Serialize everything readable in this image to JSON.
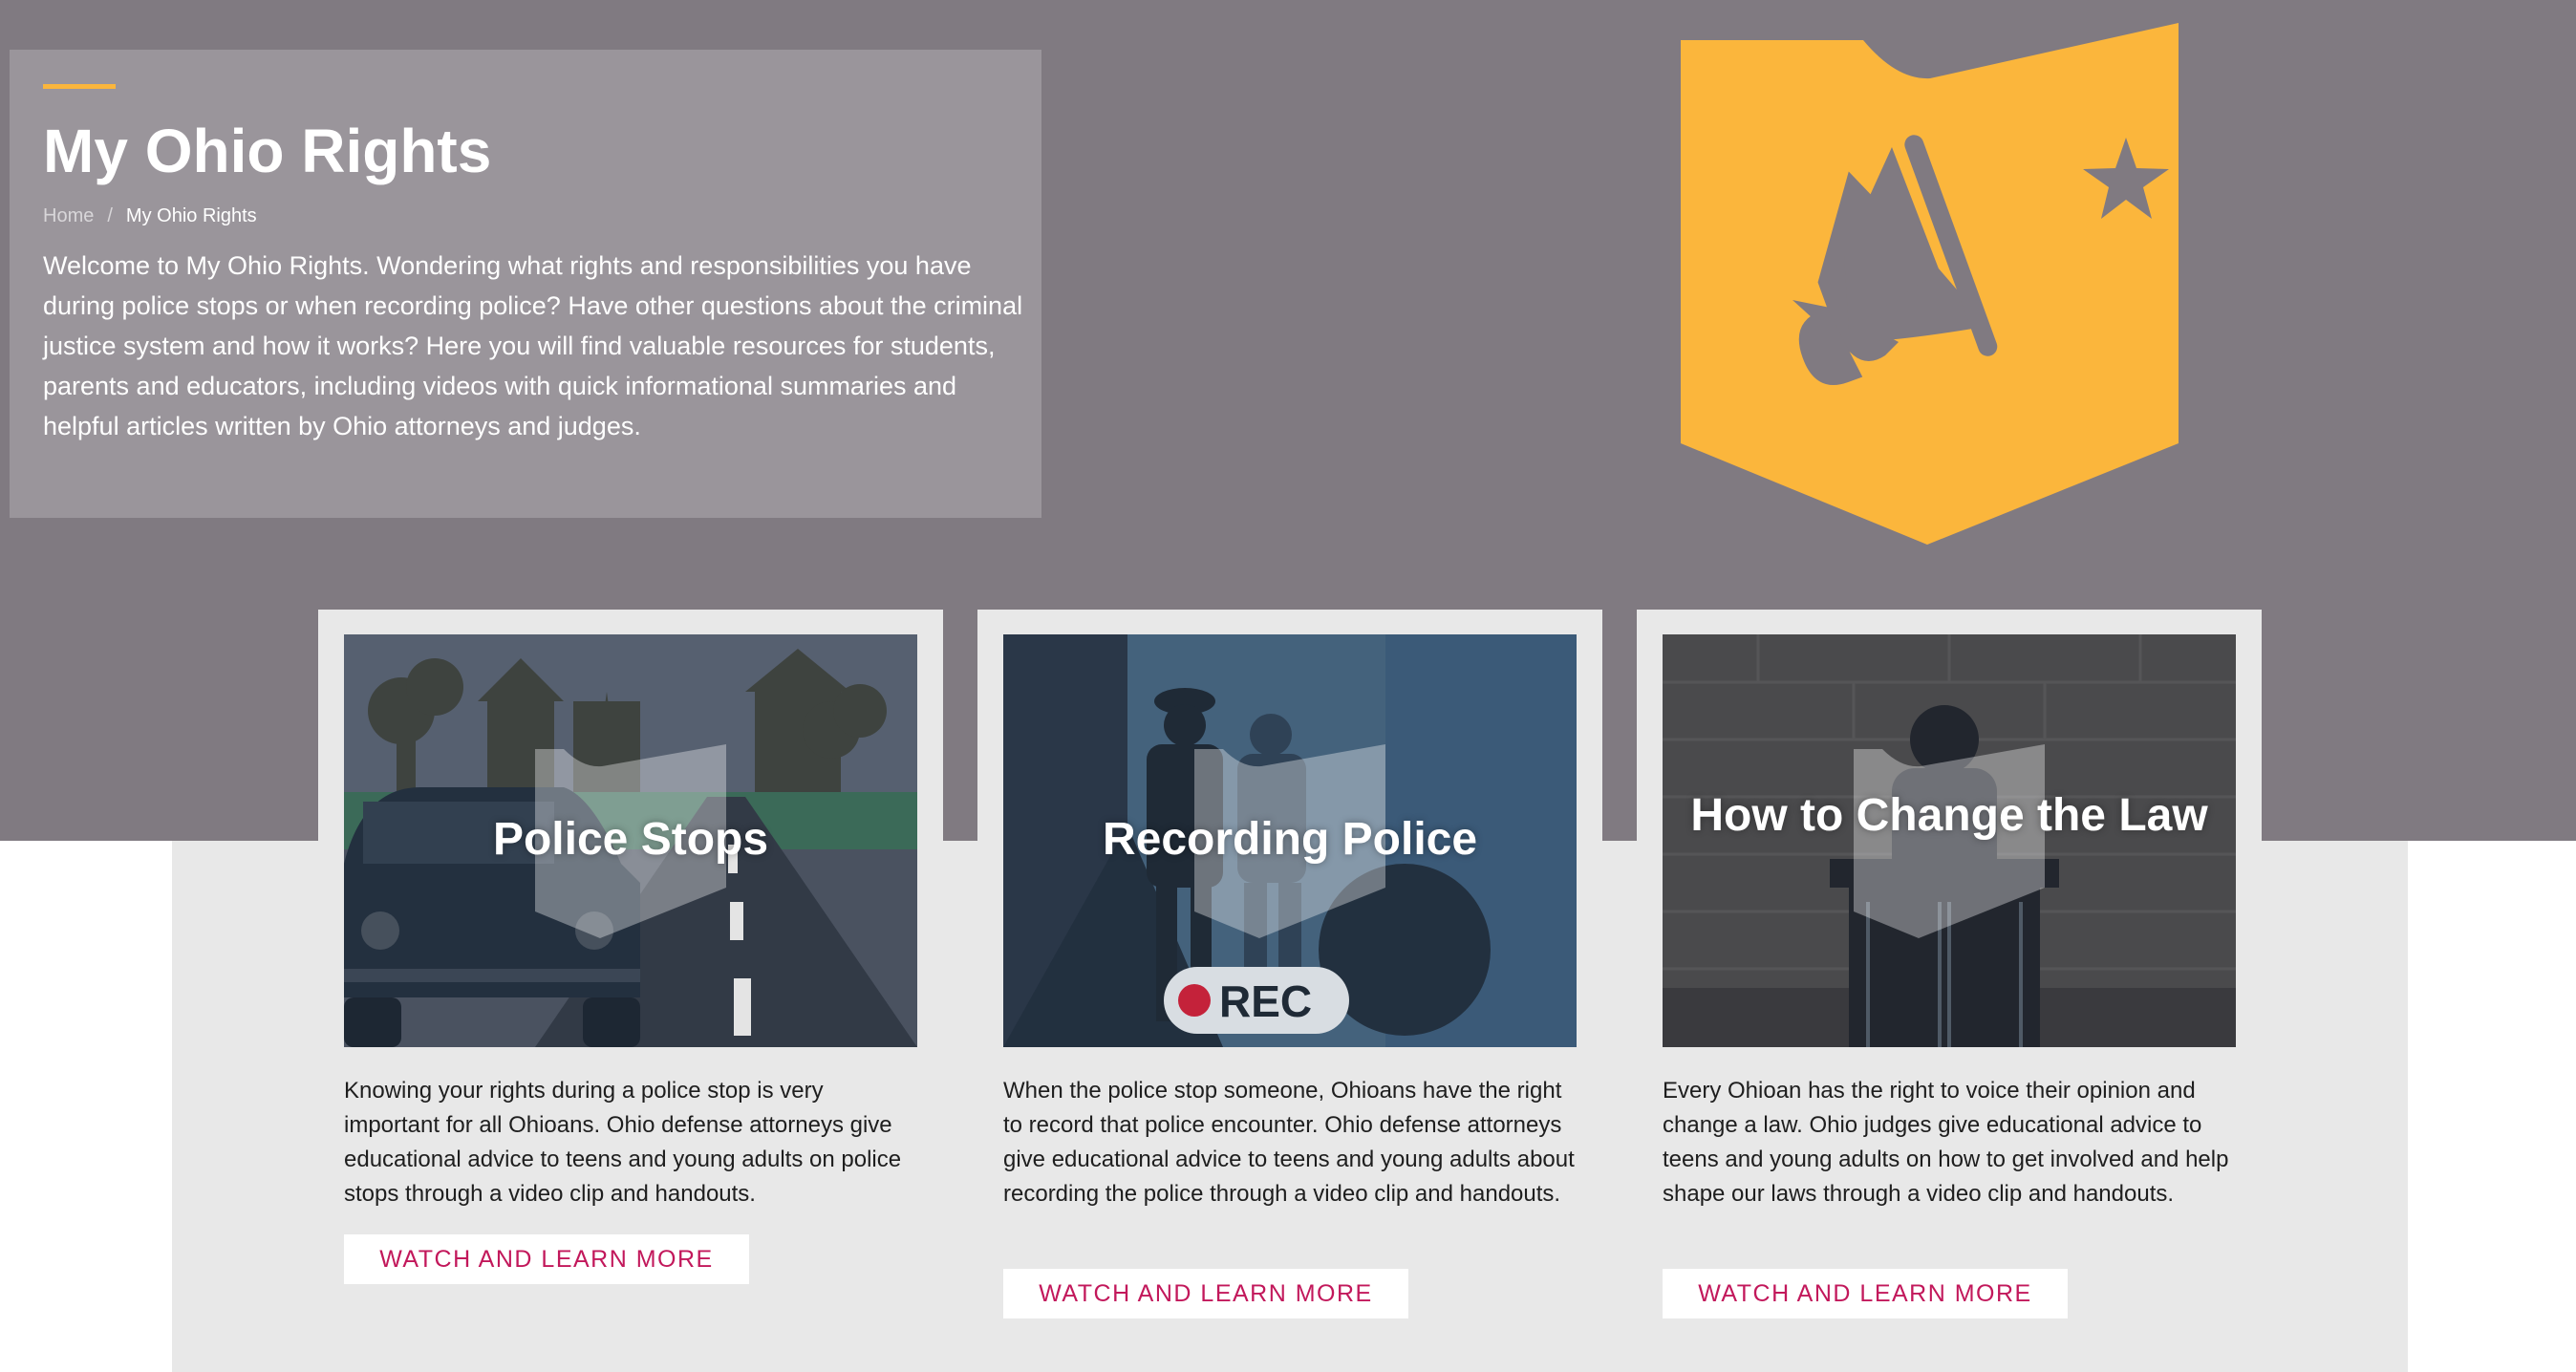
{
  "header": {
    "title": "My Ohio Rights",
    "breadcrumb": {
      "home": "Home",
      "separator": "/",
      "current": "My Ohio Rights"
    },
    "intro": "Welcome to My Ohio Rights. Wondering what rights and responsibilities you have during police stops or when recording police? Have other questions about the criminal justice system and how it works? Here you will find valuable resources for students, parents and educators, including videos with quick informational summaries and helpful articles written by Ohio attorneys and judges."
  },
  "badge_icon": "megaphone-shield-icon",
  "colors": {
    "hero_background": "#807a81",
    "intro_panel": "#9a959b",
    "accent_yellow": "#fbb63c",
    "cta_text": "#c2185b",
    "band": "#e8e8e8"
  },
  "cards": [
    {
      "title": "Police Stops",
      "image": "police-stop-illustration",
      "description": "Knowing your rights during a police stop is very important for all Ohioans. Ohio defense attorneys give educational advice to teens and young adults on police stops through a video clip and handouts.",
      "cta": "WATCH AND LEARN MORE"
    },
    {
      "title": "Recording Police",
      "image": "recording-police-illustration",
      "rec_label": "REC",
      "description": "When the police stop someone, Ohioans have the right to record that police encounter. Ohio defense attorneys give educational advice to teens and young adults about recording the police through a video clip and handouts.",
      "cta": "WATCH AND LEARN MORE"
    },
    {
      "title": "How to Change the Law",
      "image": "change-the-law-illustration",
      "description": "Every Ohioan has the right to voice their opinion and change a law. Ohio judges give educational advice to teens and young adults on how to get involved and help shape our laws through a video clip and handouts.",
      "cta": "WATCH AND LEARN MORE"
    }
  ]
}
